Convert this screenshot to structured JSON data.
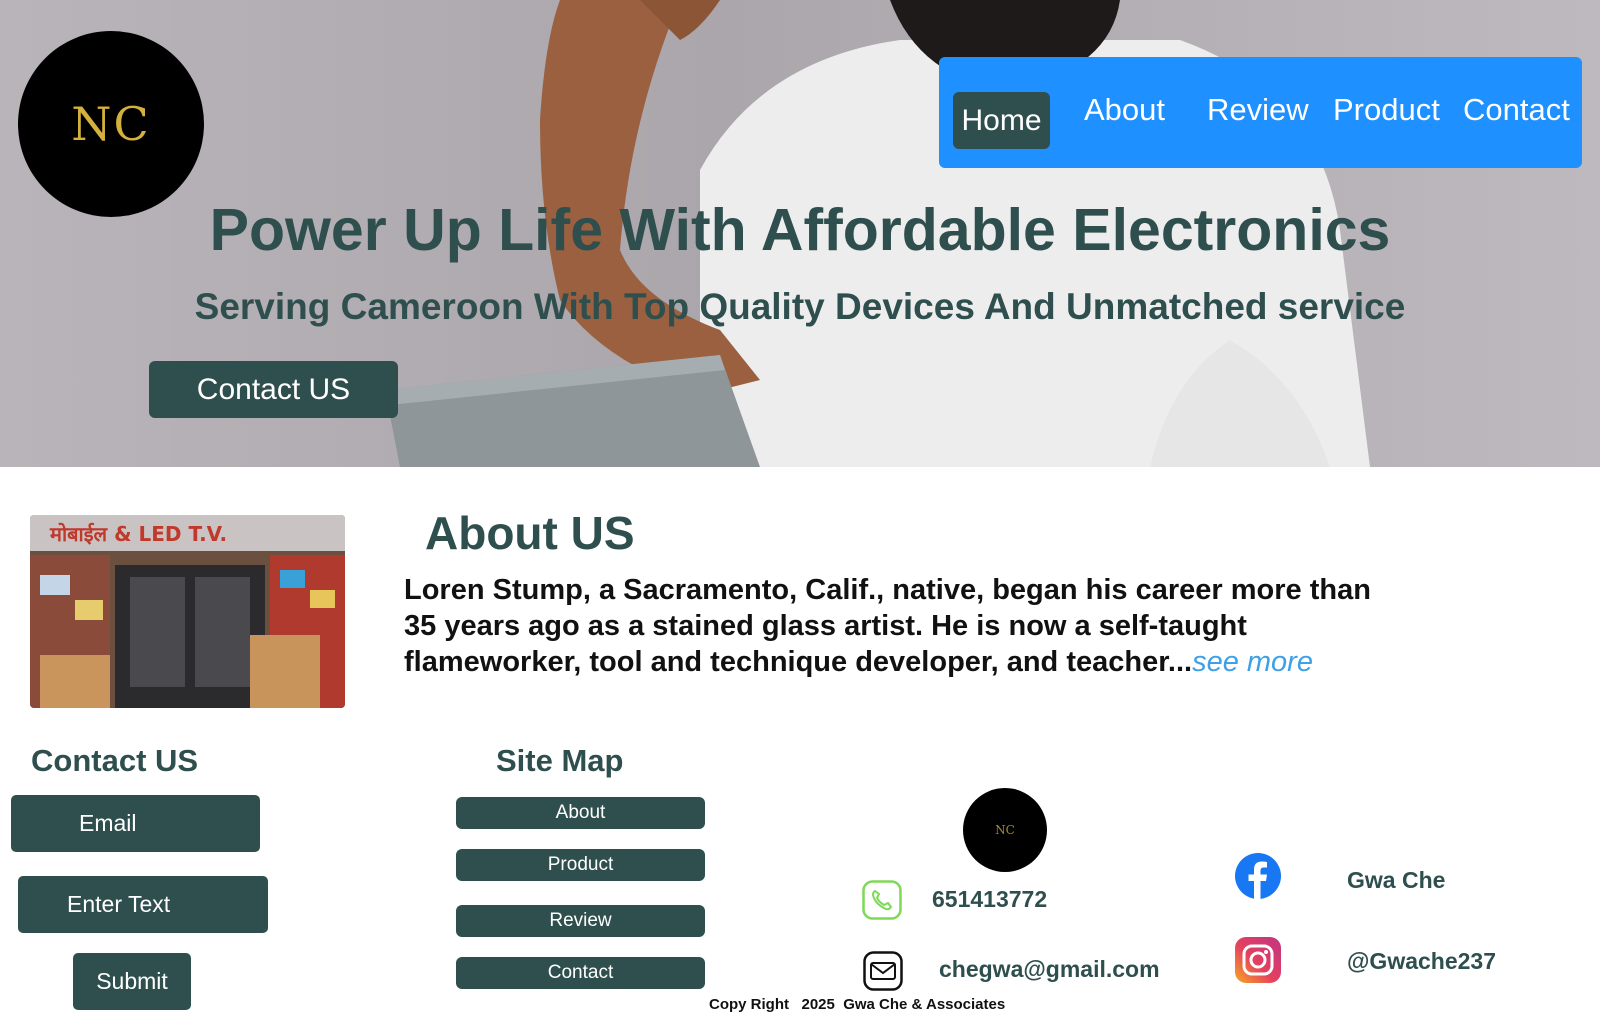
{
  "hero": {
    "logo_text": "NC",
    "title": "Power Up Life With Affordable Electronics",
    "subtitle": "Serving Cameroon With Top Quality Devices And Unmatched service",
    "cta_label": "Contact US"
  },
  "nav": {
    "items": [
      "Home",
      "About",
      "Review",
      "Product",
      "Contact"
    ],
    "active": "Home",
    "bg_color": "#1e90ff",
    "active_color": "#2f4f4f"
  },
  "about": {
    "title": "About US",
    "body": "Loren Stump, a Sacramento, Calif., native, began his career more than 35 years ago as a stained glass artist. He is now a self-taught flameworker, tool and technique developer, and teacher...",
    "see_more": "see more",
    "image_sign": "मोबाईल & LED T.V."
  },
  "contact_form": {
    "title": "Contact US",
    "email_label": "Email",
    "text_label": "Enter Text",
    "submit_label": "Submit"
  },
  "site_map": {
    "title": "Site Map",
    "links": [
      "About",
      "Product",
      "Review",
      "Contact"
    ]
  },
  "contact_info": {
    "logo_text": "NC",
    "phone": "651413772",
    "email": "chegwa@gmail.com",
    "facebook": "Gwa Che",
    "instagram": "@Gwache237"
  },
  "footer": {
    "copyright": "Copy Right   2025  Gwa Che & Associates"
  },
  "colors": {
    "primary_dark": "#2f4f4f",
    "link_blue": "#3ea0e6",
    "phone_green": "#7ed957",
    "facebook_blue": "#1877f2"
  }
}
